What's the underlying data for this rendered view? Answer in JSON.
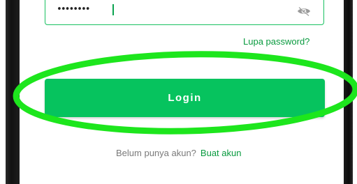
{
  "login_form": {
    "password_value": "••••••••",
    "forgot_password_link": "Lupa password?",
    "login_button": "Login",
    "signup_prompt": "Belum punya akun?",
    "signup_link": "Buat akun"
  },
  "icons": {
    "password_visibility": "eye-icon"
  },
  "colors": {
    "accent": "#06c35e",
    "link": "#089a3e",
    "field_border": "#19c161",
    "annotation": "#1de61d",
    "muted_text": "#7a7a7a"
  }
}
